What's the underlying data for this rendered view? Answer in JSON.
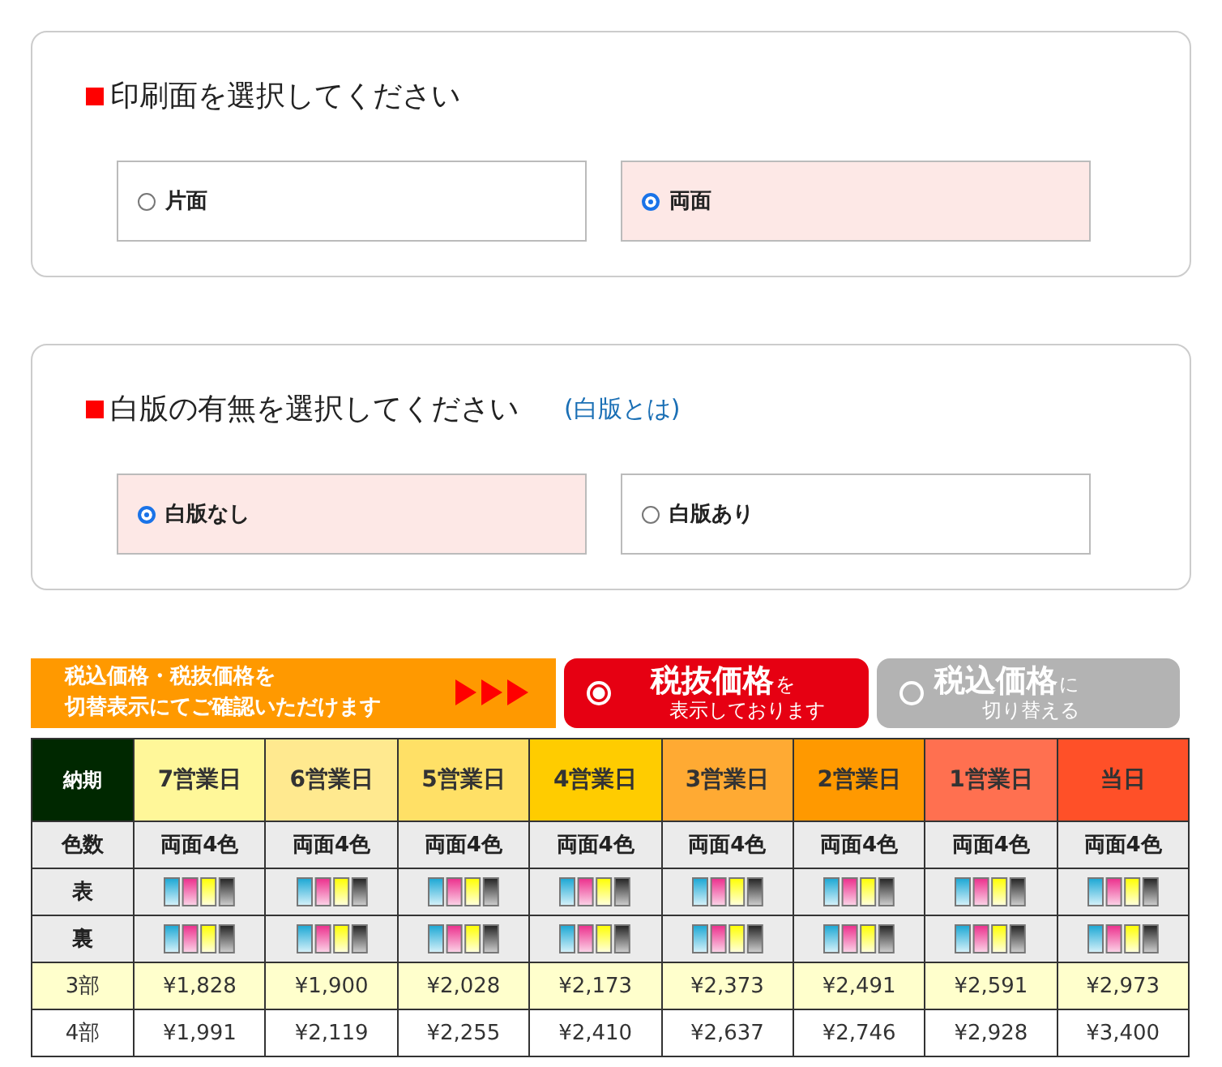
{
  "sections": [
    {
      "title": "印刷面を選択してください",
      "options": [
        {
          "label": "片面",
          "selected": false
        },
        {
          "label": "両面",
          "selected": true
        }
      ]
    },
    {
      "title": "白版の有無を選択してください",
      "link": "(白版とは)",
      "options": [
        {
          "label": "白版なし",
          "selected": true
        },
        {
          "label": "白版あり",
          "selected": false
        }
      ]
    }
  ],
  "tax_banner": {
    "notice": [
      "税込価格・税抜価格を",
      "切替表示にてご確認いただけます"
    ],
    "toggles": [
      {
        "title": "税抜価格",
        "suffix": "を",
        "subtitle": "表示しております",
        "selected": true
      },
      {
        "title": "税込価格",
        "suffix": "に",
        "subtitle": "切り替える",
        "selected": false
      }
    ]
  },
  "table": {
    "corner": "納期",
    "columns": [
      {
        "label": "7営業日",
        "color": "#fff799"
      },
      {
        "label": "6営業日",
        "color": "#ffe98f"
      },
      {
        "label": "5営業日",
        "color": "#ffe066"
      },
      {
        "label": "4営業日",
        "color": "#ffcc00"
      },
      {
        "label": "3営業日",
        "color": "#ffaa33"
      },
      {
        "label": "2営業日",
        "color": "#ff9900"
      },
      {
        "label": "1営業日",
        "color": "#ff7050"
      },
      {
        "label": "当日",
        "color": "#ff5028"
      }
    ],
    "spec_rows": [
      {
        "kind": "text",
        "label": "色数",
        "values": [
          "両面4色",
          "両面4色",
          "両面4色",
          "両面4色",
          "両面4色",
          "両面4色",
          "両面4色",
          "両面4色"
        ]
      },
      {
        "kind": "ink",
        "label": "表"
      },
      {
        "kind": "ink",
        "label": "裏"
      }
    ],
    "price_rows": [
      {
        "label": "3部",
        "prices": [
          "¥1,828",
          "¥1,900",
          "¥2,028",
          "¥2,173",
          "¥2,373",
          "¥2,491",
          "¥2,591",
          "¥2,973"
        ]
      },
      {
        "label": "4部",
        "prices": [
          "¥1,991",
          "¥2,119",
          "¥2,255",
          "¥2,410",
          "¥2,637",
          "¥2,746",
          "¥2,928",
          "¥3,400"
        ]
      }
    ]
  }
}
